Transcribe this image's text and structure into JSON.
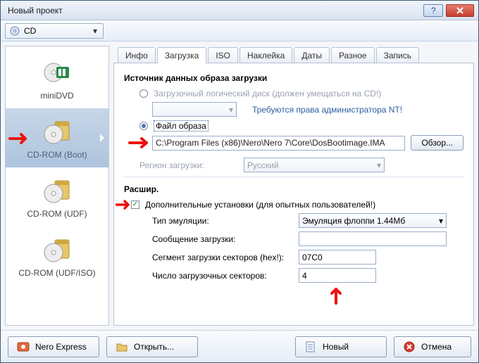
{
  "window": {
    "title": "Новый проект"
  },
  "toolbar": {
    "dropdown_label": "CD"
  },
  "sidebar": {
    "items": [
      {
        "label": "miniDVD"
      },
      {
        "label": "CD-ROM (Boot)"
      },
      {
        "label": "CD-ROM (UDF)"
      },
      {
        "label": "CD-ROM (UDF/ISO)"
      }
    ]
  },
  "tabs": {
    "items": [
      {
        "label": "Инфо"
      },
      {
        "label": "Загрузка"
      },
      {
        "label": "ISO"
      },
      {
        "label": "Наклейка"
      },
      {
        "label": "Даты"
      },
      {
        "label": "Разное"
      },
      {
        "label": "Запись"
      }
    ],
    "active_index": 1
  },
  "boot": {
    "source_title": "Источник данных образа загрузки",
    "radio_logical": "Загрузочный логический диск (должен умещаться на CD!)",
    "admin_note": "Требуются права администратора NT!",
    "radio_image": "Файл образа",
    "image_path": "C:\\Program Files (x86)\\Nero\\Nero 7\\Core\\DosBootimage.IMA",
    "browse": "Обзор...",
    "region_label": "Регион загрузки:",
    "region_value": "Русский",
    "advanced_title": "Расшир.",
    "advanced_check": "Дополнительные установки (для опытных пользователей!)",
    "emu_label": "Тип эмуляции:",
    "emu_value": "Эмуляция флоппи 1.44Мб",
    "msg_label": "Сообщение загрузки:",
    "msg_value": "",
    "seg_label": "Сегмент загрузки секторов (hex!):",
    "seg_value": "07C0",
    "count_label": "Число загрузочных секторов:",
    "count_value": "4"
  },
  "footer": {
    "nero_express": "Nero Express",
    "open": "Открыть...",
    "new": "Новый",
    "cancel": "Отмена"
  }
}
